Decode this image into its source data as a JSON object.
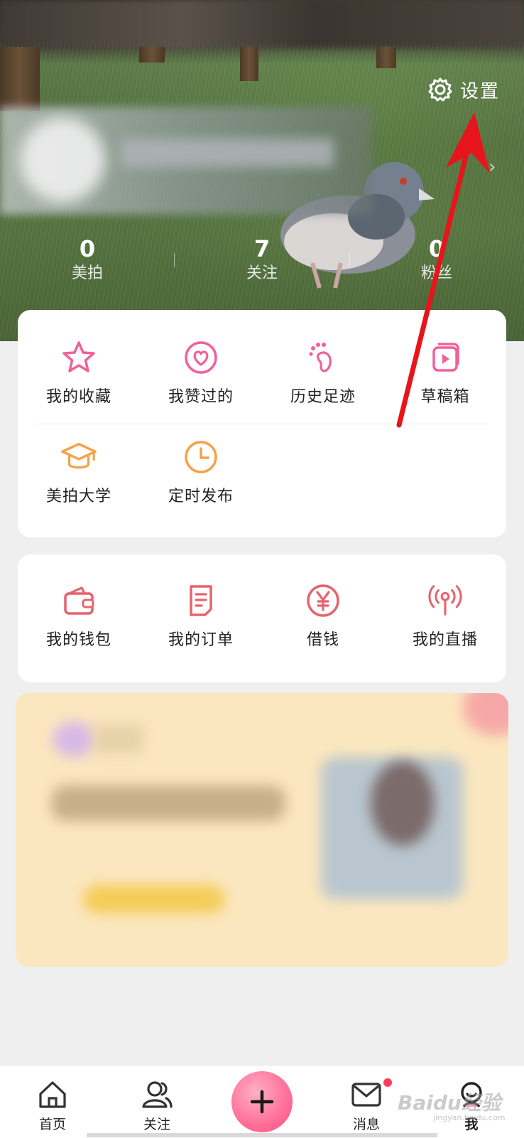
{
  "header": {
    "settings_label": "设置",
    "stats": [
      {
        "value": "0",
        "label": "美拍"
      },
      {
        "value": "7",
        "label": "关注"
      },
      {
        "value": "0",
        "label": "粉丝"
      }
    ]
  },
  "features": {
    "row1": [
      {
        "label": "我的收藏",
        "icon": "star-icon"
      },
      {
        "label": "我赞过的",
        "icon": "heart-icon"
      },
      {
        "label": "历史足迹",
        "icon": "footprint-icon"
      },
      {
        "label": "草稿箱",
        "icon": "draft-box-icon"
      }
    ],
    "row2": [
      {
        "label": "美拍大学",
        "icon": "graduation-cap-icon"
      },
      {
        "label": "定时发布",
        "icon": "clock-icon"
      }
    ]
  },
  "services": [
    {
      "label": "我的钱包",
      "icon": "wallet-icon"
    },
    {
      "label": "我的订单",
      "icon": "order-icon"
    },
    {
      "label": "借钱",
      "icon": "yen-icon"
    },
    {
      "label": "我的直播",
      "icon": "live-broadcast-icon"
    }
  ],
  "tabbar": {
    "tabs": [
      {
        "label": "首页",
        "icon": "home-icon"
      },
      {
        "label": "关注",
        "icon": "follow-icon"
      },
      {
        "label": "消息",
        "icon": "message-icon"
      },
      {
        "label": "我",
        "icon": "me-icon"
      }
    ]
  },
  "colors": {
    "accent_pink": "#f0619a",
    "accent_orange": "#f5a247",
    "accent_red": "#e5646e",
    "annotation_red": "#e8141c"
  },
  "watermark": {
    "text": "Baidu经验",
    "sub": "jingyan.baidu.com"
  }
}
